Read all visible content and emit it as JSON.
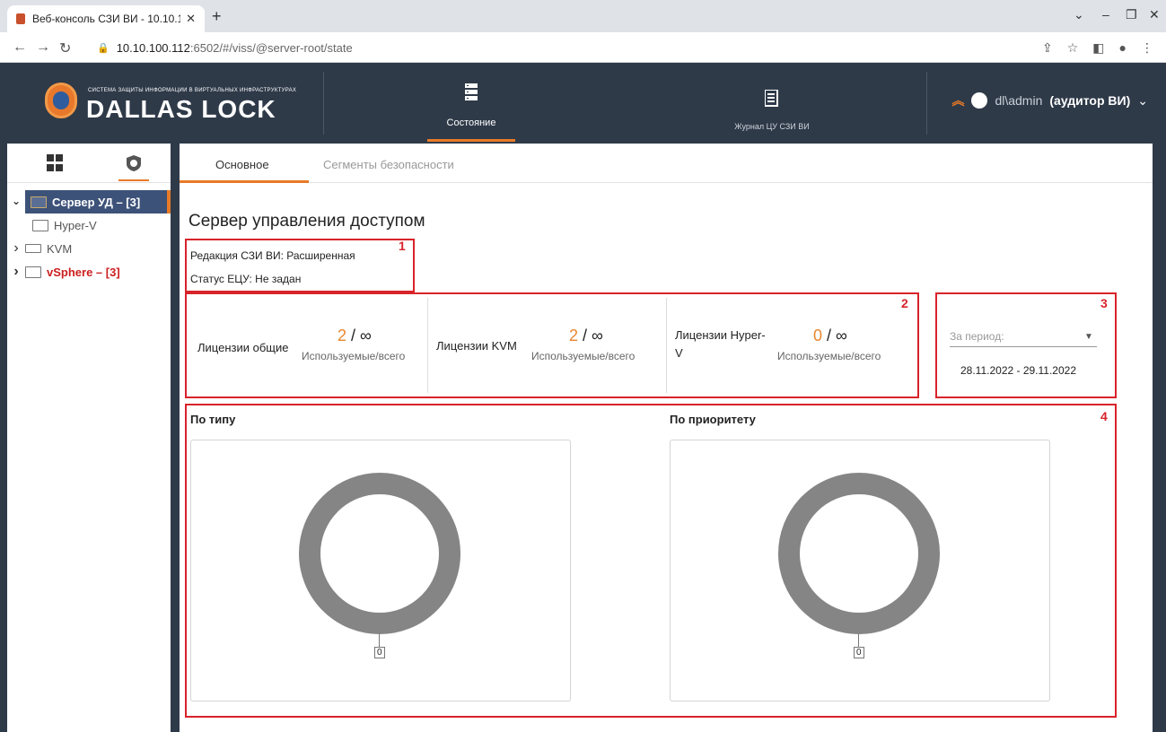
{
  "browser": {
    "tab_title": "Веб-консоль СЗИ ВИ - 10.10.10(",
    "tab_close": "✕",
    "new_tab": "+",
    "url_host": "10.10.100.112",
    "url_path": ":6502/#/viss/@server-root/state"
  },
  "header": {
    "logo_small": "СИСТЕМА ЗАЩИТЫ ИНФОРМАЦИИ В ВИРТУАЛЬНЫХ ИНФРАСТРУКТУРАХ",
    "logo_big": "DALLAS LOCK",
    "tabs": [
      {
        "label": "Состояние"
      },
      {
        "label": "Журнал ЦУ СЗИ ВИ"
      }
    ],
    "user_name": "dl\\admin",
    "user_role": "(аудитор ВИ)"
  },
  "tree": {
    "items": [
      {
        "label": "Сервер УД – [3]",
        "chevron": "⌄"
      },
      {
        "label": "Hyper-V",
        "chevron": ""
      },
      {
        "label": "KVM",
        "chevron": "›"
      },
      {
        "label": "vSphere – [3]",
        "chevron": "›"
      }
    ]
  },
  "main": {
    "tabs": [
      {
        "label": "Основное"
      },
      {
        "label": "Сегменты безопасности"
      }
    ],
    "title": "Сервер управления доступом",
    "edition": "Редакция СЗИ ВИ: Расширенная",
    "status": "Статус ЕЦУ: Не задан",
    "licenses": [
      {
        "label": "Лицензии общие",
        "used": "2",
        "total": "/ ∞",
        "sub": "Используемые/всего"
      },
      {
        "label": "Лицензии KVM",
        "used": "2",
        "total": "/ ∞",
        "sub": "Используемые/всего"
      },
      {
        "label_line1": "Лицензии Hyper-",
        "label_line2": "V",
        "used": "0",
        "total": "/ ∞",
        "sub": "Используемые/всего"
      }
    ],
    "period_label": "За период:",
    "period_dates": "28.11.2022 - 29.11.2022",
    "charts": [
      {
        "title": "По типу",
        "value": "0"
      },
      {
        "title": "По приоритету",
        "value": "0"
      }
    ],
    "annotations": [
      "1",
      "2",
      "3",
      "4"
    ]
  },
  "colors": {
    "accent": "#e87a27",
    "annotation": "#d8232a",
    "header_bg": "#2f3a49",
    "donut": "#858585"
  }
}
